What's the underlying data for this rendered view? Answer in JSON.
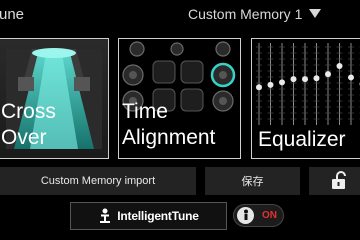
{
  "header": {
    "title": "une",
    "memory_selected": "Custom Memory 1"
  },
  "tiles": {
    "crossover": {
      "line1": "Cross",
      "line2": "Over"
    },
    "time_alignment": {
      "line1": "Time",
      "line2": "Alignment"
    },
    "equalizer": {
      "label": "Equalizer"
    }
  },
  "equalizer_levels": [
    0.46,
    0.49,
    0.52,
    0.56,
    0.56,
    0.57,
    0.62,
    0.72,
    0.58,
    0.5
  ],
  "buttons": {
    "import_label": "Custom Memory import",
    "save_label": "保存",
    "intelligent_tune_label": "IntelligentTune"
  },
  "toggle": {
    "state_label": "ON"
  },
  "colors": {
    "accent_teal": "#38d3c6",
    "toggle_on": "#e53030"
  }
}
